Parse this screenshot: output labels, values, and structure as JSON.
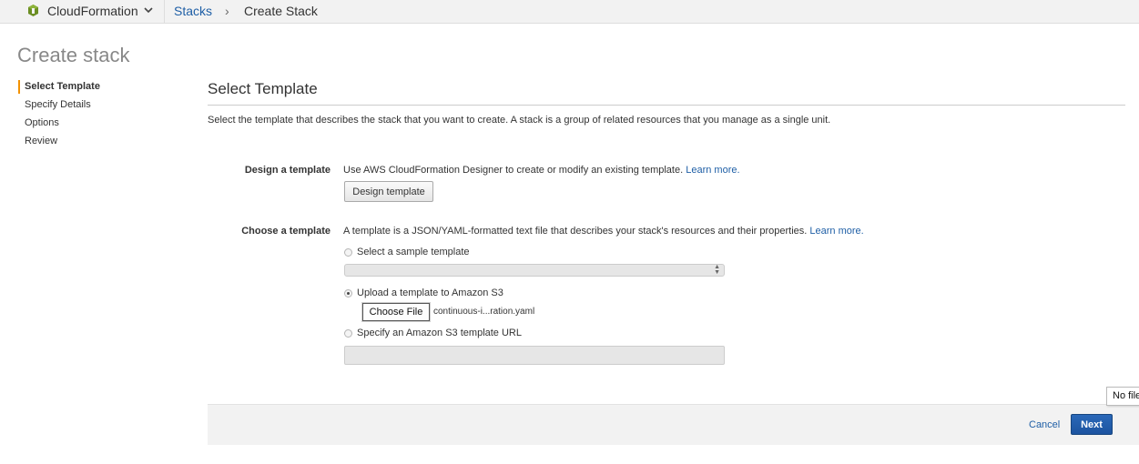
{
  "header": {
    "service_name": "CloudFormation",
    "service_icon": "cloudformation-cube-icon",
    "breadcrumb": {
      "link": "Stacks",
      "separator": "›",
      "current": "Create Stack"
    }
  },
  "page_title": "Create stack",
  "steps": [
    {
      "label": "Select Template",
      "active": true
    },
    {
      "label": "Specify Details",
      "active": false
    },
    {
      "label": "Options",
      "active": false
    },
    {
      "label": "Review",
      "active": false
    }
  ],
  "section": {
    "title": "Select Template",
    "description": "Select the template that describes the stack that you want to create. A stack is a group of related resources that you manage as a single unit."
  },
  "design": {
    "label": "Design a template",
    "text": "Use AWS CloudFormation Designer to create or modify an existing template.",
    "learn_more": "Learn more.",
    "button": "Design template"
  },
  "choose": {
    "label": "Choose a template",
    "text": "A template is a JSON/YAML-formatted text file that describes your stack's resources and their properties.",
    "learn_more": "Learn more.",
    "options": {
      "sample": "Select a sample template",
      "upload": "Upload a template to Amazon S3",
      "url": "Specify an Amazon S3 template URL"
    },
    "selected_option": "upload",
    "sample_select_value": "",
    "file_button": "Choose File",
    "file_name": "continuous-i...ration.yaml",
    "url_value": ""
  },
  "footer": {
    "cancel": "Cancel",
    "next": "Next"
  },
  "tooltip": "No file chosen",
  "colors": {
    "link": "#1f5fa6",
    "primary": "#1f5fa6",
    "active_step_marker": "#f39200"
  }
}
